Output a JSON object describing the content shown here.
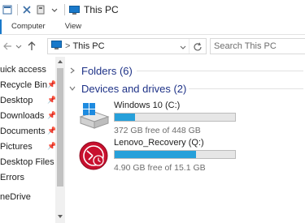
{
  "window": {
    "title": "This PC"
  },
  "ribbon": {
    "tabs": [
      "Computer",
      "View"
    ]
  },
  "address": {
    "separator": ">",
    "location": "This PC",
    "search_placeholder": "Search This PC"
  },
  "sidebar": {
    "items": [
      {
        "label": "uick access",
        "pinned": false
      },
      {
        "label": "Recycle Bin",
        "pinned": true
      },
      {
        "label": "Desktop",
        "pinned": true
      },
      {
        "label": "Downloads",
        "pinned": true
      },
      {
        "label": "Documents",
        "pinned": true
      },
      {
        "label": "Pictures",
        "pinned": true
      },
      {
        "label": "Desktop Files",
        "pinned": false
      },
      {
        "label": "Errors",
        "pinned": false
      },
      {
        "label": "neDrive",
        "pinned": false
      }
    ]
  },
  "content": {
    "folders_group": "Folders (6)",
    "devices_group": "Devices and drives (2)",
    "drives": [
      {
        "name": "Windows 10 (C:)",
        "free": "372 GB free of 448 GB",
        "used_fraction": 0.17
      },
      {
        "name": "Lenovo_Recovery (Q:)",
        "free": "4.90 GB free of 15.1 GB",
        "used_fraction": 0.675
      }
    ]
  },
  "colors": {
    "accent": "#1979ca",
    "group_title": "#1e3287",
    "drive_fill": "#26a0da",
    "recovery_red": "#c8102e"
  }
}
